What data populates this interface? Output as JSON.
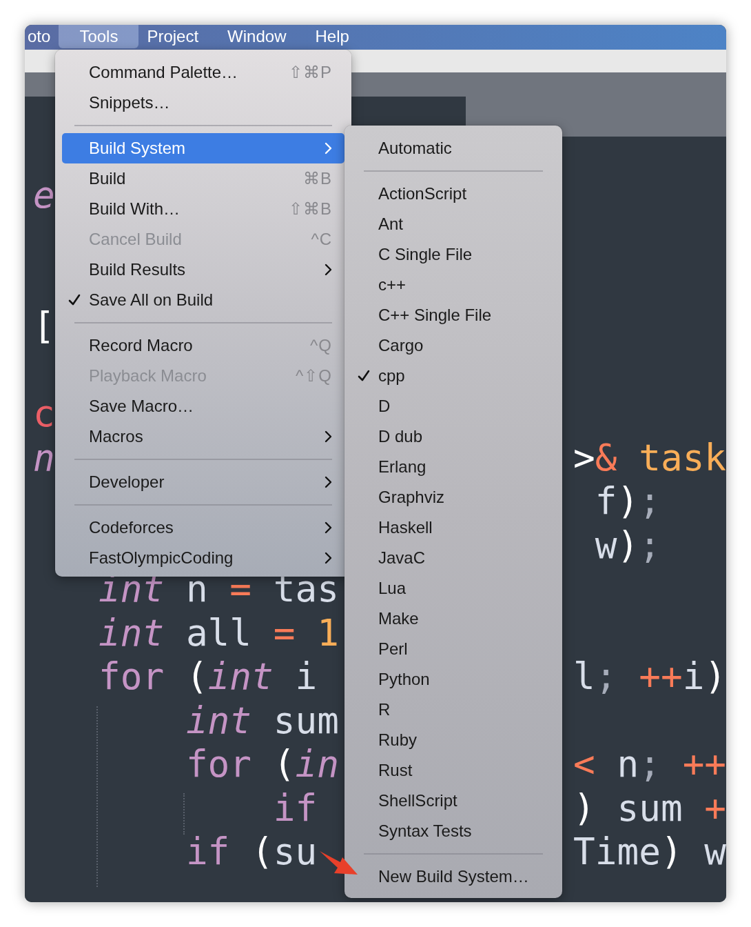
{
  "menu_bar": {
    "items": [
      {
        "label": "oto",
        "selected": false
      },
      {
        "label": "Tools",
        "selected": true
      },
      {
        "label": "Project",
        "selected": false
      },
      {
        "label": "Window",
        "selected": false
      },
      {
        "label": "Help",
        "selected": false
      }
    ]
  },
  "editor": {
    "rows": [
      {
        "kind": "blank"
      },
      {
        "kind": "code",
        "left": [
          {
            "text": "e",
            "kind": "type"
          }
        ]
      },
      {
        "kind": "blank"
      },
      {
        "kind": "blank"
      },
      {
        "kind": "code",
        "left": [
          {
            "text": "[",
            "kind": "punct"
          }
        ]
      },
      {
        "kind": "blank"
      },
      {
        "kind": "code",
        "left": [
          {
            "text": "c",
            "kind": "literal"
          }
        ]
      },
      {
        "kind": "code",
        "left": [
          {
            "text": "n",
            "kind": "type"
          }
        ],
        "right": [
          {
            "text": ">",
            "kind": "punct"
          },
          {
            "text": "&",
            "kind": "op"
          },
          {
            "text": " task",
            "kind": "param"
          }
        ]
      },
      {
        "kind": "code",
        "right": [
          {
            "text": " f",
            "kind": "ident"
          },
          {
            "text": ")",
            "kind": "punct"
          },
          {
            "text": ";",
            "kind": "semi"
          }
        ]
      },
      {
        "kind": "code",
        "right": [
          {
            "text": " w",
            "kind": "ident"
          },
          {
            "text": ")",
            "kind": "punct"
          },
          {
            "text": ";",
            "kind": "semi"
          }
        ]
      }
    ],
    "body": [
      {
        "left": [
          {
            "text": "int",
            "kind": "type"
          },
          {
            "text": " n",
            "kind": "ident"
          },
          {
            "text": " =",
            "kind": "op"
          },
          {
            "text": " tas",
            "kind": "ident"
          }
        ]
      },
      {
        "left": [
          {
            "text": "int",
            "kind": "type"
          },
          {
            "text": " all",
            "kind": "ident"
          },
          {
            "text": " =",
            "kind": "op"
          },
          {
            "text": " 1",
            "kind": "number"
          }
        ]
      },
      {
        "left": [
          {
            "text": "for",
            "kind": "keyword"
          },
          {
            "text": " (",
            "kind": "punct"
          },
          {
            "text": "int",
            "kind": "type"
          },
          {
            "text": " i",
            "kind": "ident"
          }
        ],
        "right": [
          {
            "text": "l",
            "kind": "ident"
          },
          {
            "text": ";",
            "kind": "semi"
          },
          {
            "text": " ++",
            "kind": "op"
          },
          {
            "text": "i",
            "kind": "ident"
          },
          {
            "text": ")",
            "kind": "punct"
          }
        ],
        "children": [
          {
            "left": [
              {
                "text": "int",
                "kind": "type"
              },
              {
                "text": " sum",
                "kind": "ident"
              }
            ]
          },
          {
            "left": [
              {
                "text": "for",
                "kind": "keyword"
              },
              {
                "text": " (",
                "kind": "punct"
              },
              {
                "text": "in",
                "kind": "type"
              }
            ],
            "right": [
              {
                "text": "<",
                "kind": "op"
              },
              {
                "text": " n",
                "kind": "ident"
              },
              {
                "text": ";",
                "kind": "semi"
              },
              {
                "text": " ++",
                "kind": "op"
              }
            ],
            "children": [
              {
                "left": [
                  {
                    "text": "if",
                    "kind": "keyword"
                  }
                ],
                "right": [
                  {
                    "text": ")",
                    "kind": "punct"
                  },
                  {
                    "text": " sum",
                    "kind": "ident"
                  },
                  {
                    "text": " +",
                    "kind": "op"
                  }
                ]
              }
            ]
          },
          {
            "left": [
              {
                "text": "if",
                "kind": "keyword"
              },
              {
                "text": " (",
                "kind": "punct"
              },
              {
                "text": "su",
                "kind": "ident"
              }
            ],
            "right": [
              {
                "text": "Time",
                "kind": "ident"
              },
              {
                "text": ")",
                "kind": "punct"
              },
              {
                "text": " w",
                "kind": "ident"
              }
            ]
          }
        ]
      }
    ]
  },
  "tools_menu": {
    "items": [
      {
        "kind": "item",
        "label": "Command Palette…",
        "shortcut": "⇧⌘P",
        "submenu": false,
        "checked": false,
        "disabled": false,
        "selected": false
      },
      {
        "kind": "item",
        "label": "Snippets…",
        "submenu": false,
        "checked": false,
        "disabled": false,
        "selected": false
      },
      {
        "kind": "separator"
      },
      {
        "kind": "item",
        "label": "Build System",
        "submenu": true,
        "checked": false,
        "disabled": false,
        "selected": true
      },
      {
        "kind": "item",
        "label": "Build",
        "shortcut": "⌘B",
        "submenu": false,
        "checked": false,
        "disabled": false,
        "selected": false
      },
      {
        "kind": "item",
        "label": "Build With…",
        "shortcut": "⇧⌘B",
        "submenu": false,
        "checked": false,
        "disabled": false,
        "selected": false
      },
      {
        "kind": "item",
        "label": "Cancel Build",
        "shortcut": "^C",
        "submenu": false,
        "checked": false,
        "disabled": true,
        "selected": false
      },
      {
        "kind": "item",
        "label": "Build Results",
        "submenu": true,
        "checked": false,
        "disabled": false,
        "selected": false
      },
      {
        "kind": "item",
        "label": "Save All on Build",
        "submenu": false,
        "checked": true,
        "disabled": false,
        "selected": false
      },
      {
        "kind": "separator"
      },
      {
        "kind": "item",
        "label": "Record Macro",
        "shortcut": "^Q",
        "submenu": false,
        "checked": false,
        "disabled": false,
        "selected": false
      },
      {
        "kind": "item",
        "label": "Playback Macro",
        "shortcut": "^⇧Q",
        "submenu": false,
        "checked": false,
        "disabled": true,
        "selected": false
      },
      {
        "kind": "item",
        "label": "Save Macro…",
        "submenu": false,
        "checked": false,
        "disabled": false,
        "selected": false
      },
      {
        "kind": "item",
        "label": "Macros",
        "submenu": true,
        "checked": false,
        "disabled": false,
        "selected": false
      },
      {
        "kind": "separator"
      },
      {
        "kind": "item",
        "label": "Developer",
        "submenu": true,
        "checked": false,
        "disabled": false,
        "selected": false
      },
      {
        "kind": "separator"
      },
      {
        "kind": "item",
        "label": "Codeforces",
        "submenu": true,
        "checked": false,
        "disabled": false,
        "selected": false
      },
      {
        "kind": "item",
        "label": "FastOlympicCoding",
        "submenu": true,
        "checked": false,
        "disabled": false,
        "selected": false
      }
    ]
  },
  "build_system_menu": {
    "items": [
      {
        "kind": "item",
        "label": "Automatic",
        "checked": false,
        "selected": false
      },
      {
        "kind": "separator"
      },
      {
        "kind": "item",
        "label": "ActionScript",
        "checked": false,
        "selected": false
      },
      {
        "kind": "item",
        "label": "Ant",
        "checked": false,
        "selected": false
      },
      {
        "kind": "item",
        "label": "C Single File",
        "checked": false,
        "selected": false
      },
      {
        "kind": "item",
        "label": "c++",
        "checked": false,
        "selected": false
      },
      {
        "kind": "item",
        "label": "C++ Single File",
        "checked": false,
        "selected": false
      },
      {
        "kind": "item",
        "label": "Cargo",
        "checked": false,
        "selected": false
      },
      {
        "kind": "item",
        "label": "cpp",
        "checked": true,
        "selected": false
      },
      {
        "kind": "item",
        "label": "D",
        "checked": false,
        "selected": false
      },
      {
        "kind": "item",
        "label": "D dub",
        "checked": false,
        "selected": false
      },
      {
        "kind": "item",
        "label": "Erlang",
        "checked": false,
        "selected": false
      },
      {
        "kind": "item",
        "label": "Graphviz",
        "checked": false,
        "selected": false
      },
      {
        "kind": "item",
        "label": "Haskell",
        "checked": false,
        "selected": false
      },
      {
        "kind": "item",
        "label": "JavaC",
        "checked": false,
        "selected": false
      },
      {
        "kind": "item",
        "label": "Lua",
        "checked": false,
        "selected": false
      },
      {
        "kind": "item",
        "label": "Make",
        "checked": false,
        "selected": false
      },
      {
        "kind": "item",
        "label": "Perl",
        "checked": false,
        "selected": false
      },
      {
        "kind": "item",
        "label": "Python",
        "checked": false,
        "selected": false
      },
      {
        "kind": "item",
        "label": "R",
        "checked": false,
        "selected": false
      },
      {
        "kind": "item",
        "label": "Ruby",
        "checked": false,
        "selected": false
      },
      {
        "kind": "item",
        "label": "Rust",
        "checked": false,
        "selected": false
      },
      {
        "kind": "item",
        "label": "ShellScript",
        "checked": false,
        "selected": false
      },
      {
        "kind": "item",
        "label": "Syntax Tests",
        "checked": false,
        "selected": false
      },
      {
        "kind": "separator"
      },
      {
        "kind": "item",
        "label": "New Build System…",
        "checked": false,
        "selected": false
      }
    ]
  }
}
